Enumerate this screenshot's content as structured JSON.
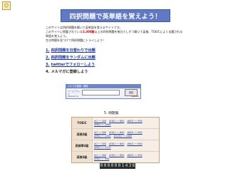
{
  "header": {
    "logo_glyph": "☺",
    "title": "四択問題で英単語を覚えよう！"
  },
  "intro": {
    "line1": "このサイトは四択問題を解いて英単語を覚えるサイトです。",
    "line2_pre": "このサイトに掲載されている",
    "line2_hl": "3,300語",
    "line2_post": "以上の四択問題を毎日少しずつ解いて英検、TOEICによく出題される単語を覚えよう。",
    "line3": "空き時間を見つけて四択問題にトライしよう！"
  },
  "menu": {
    "items": [
      {
        "num": "1.",
        "label": "四択問題を日替わりで出題"
      },
      {
        "num": "2.",
        "label": "四択問題をランダムに出題"
      },
      {
        "num": "3.",
        "label": "twitterでフォローしよう"
      },
      {
        "num": "4.",
        "label": "メルマガに登録しよう"
      }
    ]
  },
  "mailmag": {
    "title": "メルマガ登録・解除",
    "field_label": "メールアドレス",
    "field_placeholder": "",
    "button_label": "送信",
    "footer_left": "Powered by",
    "footer_brand": "melma!"
  },
  "section5": {
    "title": "5. 問題集"
  },
  "table": {
    "rows": [
      {
        "head": "TOEIC",
        "links": [
          "#1 ～ 300",
          "#301 ～ 600",
          "#601 ～ 900",
          "#901 ～ 1084"
        ]
      },
      {
        "head": "英検2級",
        "links": [
          "#1 ～ 300",
          "#301 ～ 600",
          "#601 ～ 900",
          "#901 ～ 1200",
          "#1201 ～ 1400"
        ]
      },
      {
        "head": "英検準2級",
        "links": [
          "#1 ～ 300",
          "#301 ～ 600",
          "#601 ～ 900",
          "#901 ～ 1172"
        ]
      },
      {
        "head": "英検3級",
        "links": [
          "#1 ～ 300",
          "#301 ～ 600",
          "#601 ～ 900",
          "#901 ～ 956"
        ]
      }
    ]
  },
  "counter": {
    "value": "0000001436"
  }
}
